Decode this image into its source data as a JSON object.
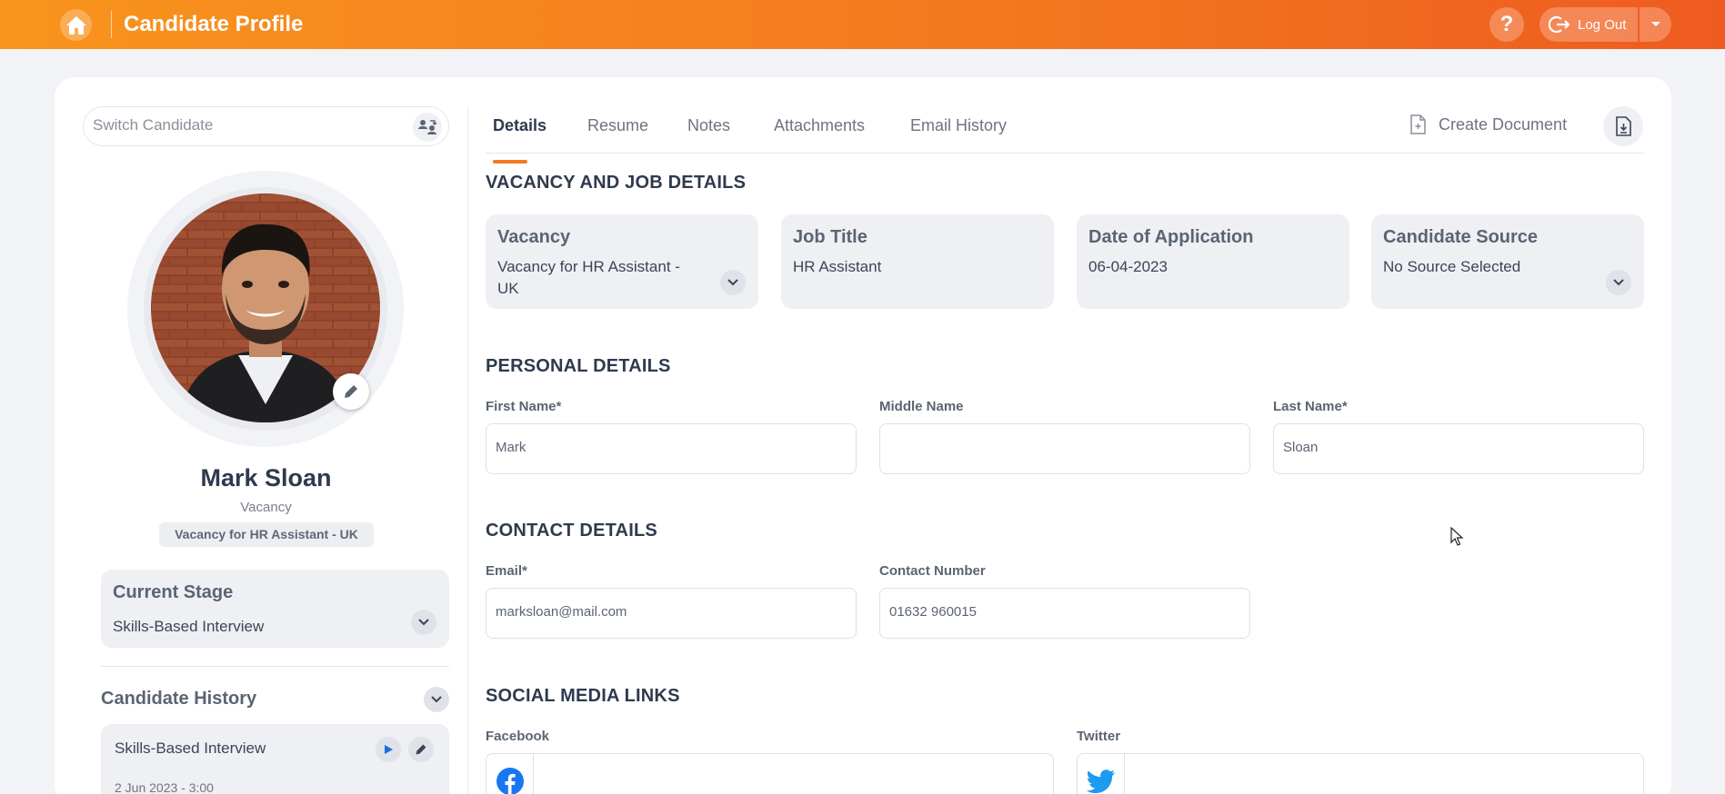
{
  "header": {
    "title": "Candidate Profile",
    "logout_label": "Log Out",
    "help_label": "?"
  },
  "sidebar": {
    "switch_placeholder": "Switch Candidate",
    "candidate_name": "Mark Sloan",
    "vacancy_label": "Vacancy",
    "vacancy_badge": "Vacancy for HR Assistant - UK",
    "current_stage": {
      "title": "Current Stage",
      "value": "Skills-Based Interview"
    },
    "history": {
      "title": "Candidate History",
      "items": [
        {
          "stage": "Skills-Based Interview",
          "date": "2 Jun 2023 - 3:00"
        }
      ]
    }
  },
  "tabs": [
    {
      "label": "Details",
      "active": true
    },
    {
      "label": "Resume",
      "active": false
    },
    {
      "label": "Notes",
      "active": false
    },
    {
      "label": "Attachments",
      "active": false
    },
    {
      "label": "Email History",
      "active": false
    }
  ],
  "create_document_label": "Create Document",
  "vacancy_section": {
    "title": "VACANCY AND JOB DETAILS",
    "cards": [
      {
        "label": "Vacancy",
        "value": "Vacancy for HR Assistant - UK"
      },
      {
        "label": "Job Title",
        "value": "HR Assistant"
      },
      {
        "label": "Date of Application",
        "value": "06-04-2023"
      },
      {
        "label": "Candidate Source",
        "value": "No Source Selected"
      }
    ]
  },
  "personal_section": {
    "title": "PERSONAL DETAILS",
    "first_name": {
      "label": "First Name*",
      "value": "Mark"
    },
    "middle_name": {
      "label": "Middle Name",
      "value": ""
    },
    "last_name": {
      "label": "Last Name*",
      "value": "Sloan"
    }
  },
  "contact_section": {
    "title": "CONTACT DETAILS",
    "email": {
      "label": "Email*",
      "value": "marksloan@mail.com"
    },
    "phone": {
      "label": "Contact Number",
      "value": "01632 960015"
    }
  },
  "social_section": {
    "title": "SOCIAL MEDIA LINKS",
    "facebook": {
      "label": "Facebook",
      "icon": "facebook-icon",
      "value": ""
    },
    "twitter": {
      "label": "Twitter",
      "icon": "twitter-icon",
      "value": ""
    }
  },
  "colors": {
    "accent": "#f47a1f",
    "facebook": "#1877f2",
    "twitter": "#1d9bf0"
  }
}
